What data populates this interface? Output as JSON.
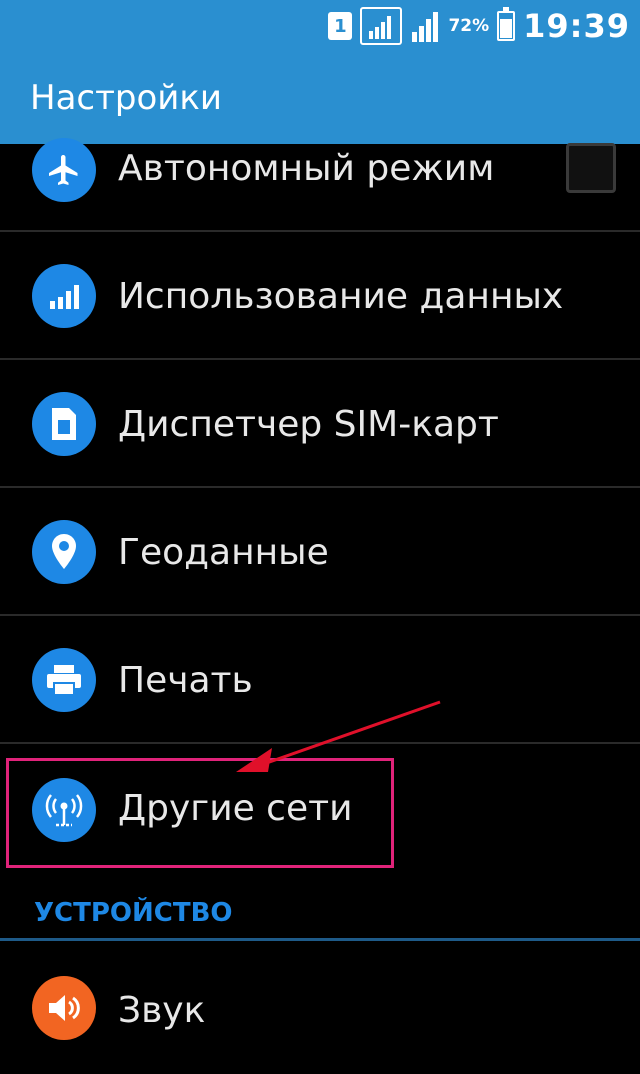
{
  "status_bar": {
    "sim_label": "1",
    "battery_percent": "72%",
    "battery_level": 0.72,
    "time": "19:39"
  },
  "app_bar": {
    "title": "Настройки"
  },
  "items": [
    {
      "label": "Автономный режим",
      "icon": "airplane-icon",
      "has_checkbox": true,
      "checked": false
    },
    {
      "label": "Использование данных",
      "icon": "data-usage-icon"
    },
    {
      "label": "Диспетчер SIM-карт",
      "icon": "sim-card-icon"
    },
    {
      "label": "Геоданные",
      "icon": "location-pin-icon"
    },
    {
      "label": "Печать",
      "icon": "printer-icon"
    },
    {
      "label": "Другие сети",
      "icon": "wireless-antenna-icon",
      "highlighted": true
    }
  ],
  "section": {
    "label": "УСТРОЙСТВО"
  },
  "device_items": [
    {
      "label": "Звук",
      "icon": "speaker-icon"
    }
  ],
  "colors": {
    "accent": "#2a8fd0",
    "icon_bg": "#1e88e5",
    "sound_icon_bg": "#f26522",
    "highlight_border": "#e0237a",
    "arrow": "#e0102a"
  }
}
